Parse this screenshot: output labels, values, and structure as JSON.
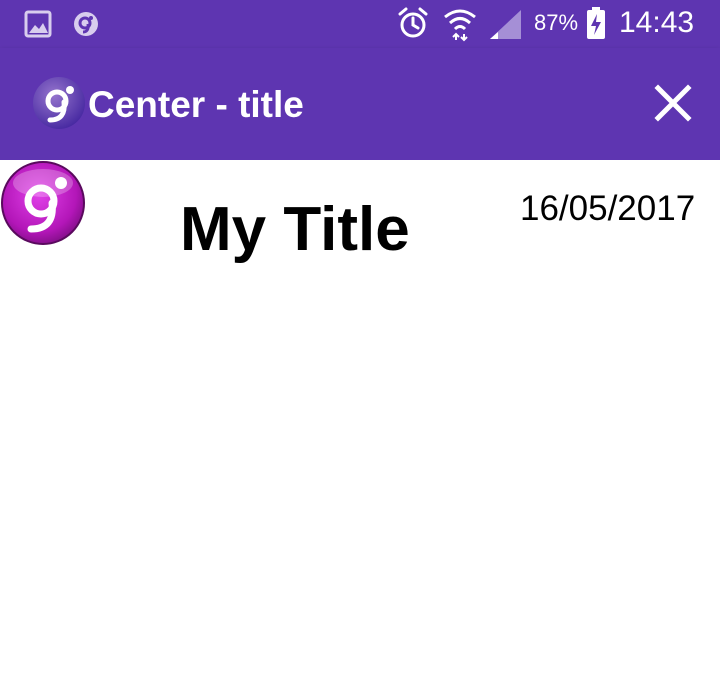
{
  "status_bar": {
    "icons": [
      "gallery-icon",
      "app-notification-icon",
      "alarm-icon",
      "wifi-icon",
      "signal-icon",
      "battery-charging-icon"
    ],
    "battery_percent": "87%",
    "time": "14:43"
  },
  "app_bar": {
    "logo": "app-logo-icon",
    "title": "Center - title",
    "close_icon": "close-icon"
  },
  "content": {
    "logo": "item-logo-icon",
    "title": "My Title",
    "date": "16/05/2017"
  },
  "colors": {
    "primary": "#5e35b1",
    "logo_magenta": "#c21fc9",
    "text": "#000000",
    "background": "#ffffff"
  }
}
